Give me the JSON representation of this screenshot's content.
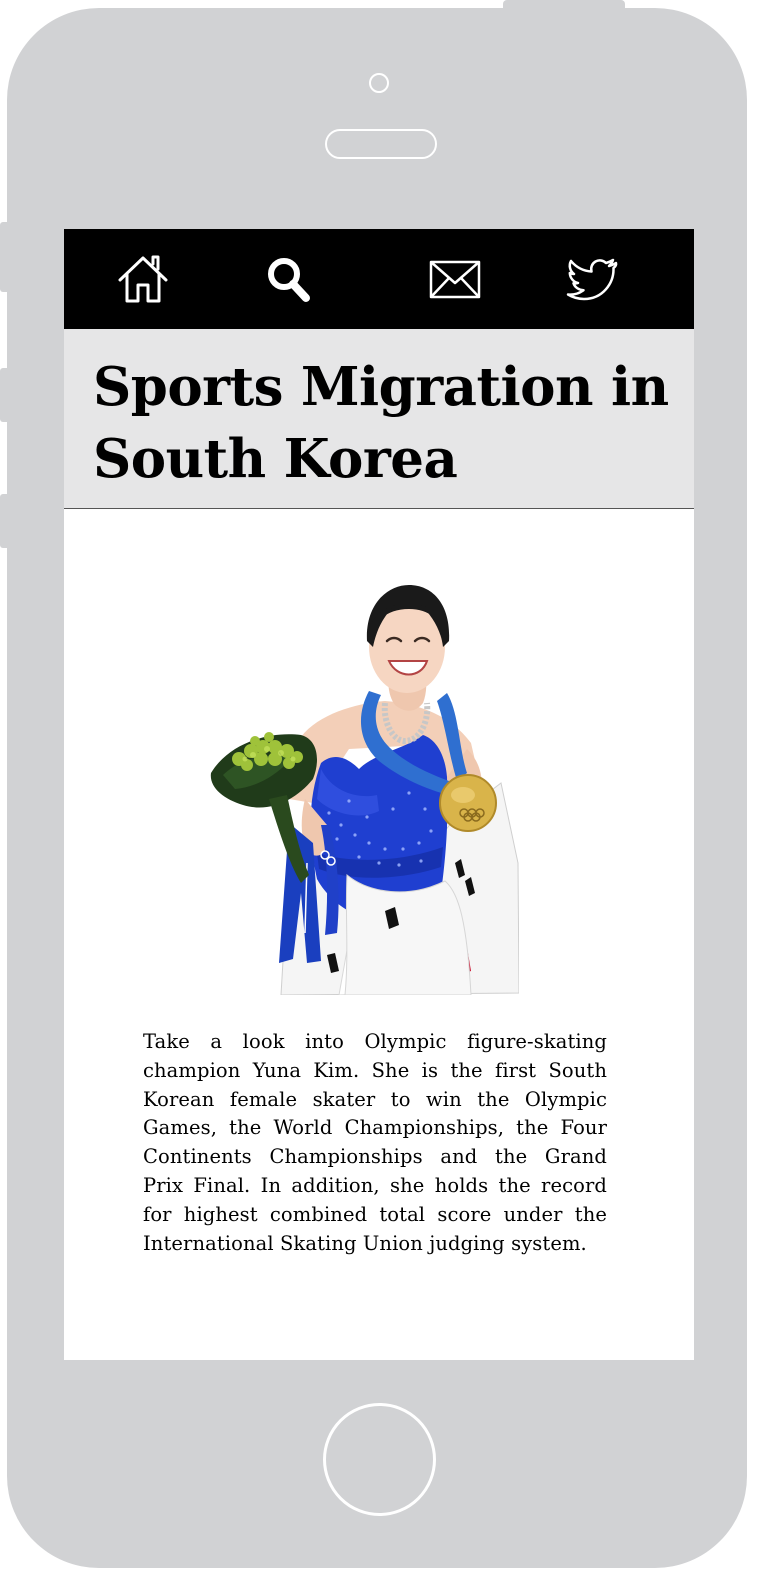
{
  "navbar": {
    "items": [
      {
        "icon": "home-icon"
      },
      {
        "icon": "search-icon"
      },
      {
        "icon": "mail-icon"
      },
      {
        "icon": "twitter-icon"
      }
    ]
  },
  "article": {
    "title": "Sports Migration in South Korea",
    "image": {
      "subject": "Yuna Kim holding a bouquet, a gold medal and the South Korean flag"
    },
    "body": "Take a look into Olympic figure-skating champion Yuna Kim. She is the first South Korean female skater to win the Olympic Games, the World Championships, the Four Continents Championships and the Grand Prix Final. In addition, she holds the record for highest combined total score under the International Skating Union judging system."
  },
  "colors": {
    "device": "#d1d2d4",
    "navbar": "#000000",
    "title_band": "#e6e6e7",
    "dress": "#1f3fd0",
    "medal": "#d9b44a"
  }
}
